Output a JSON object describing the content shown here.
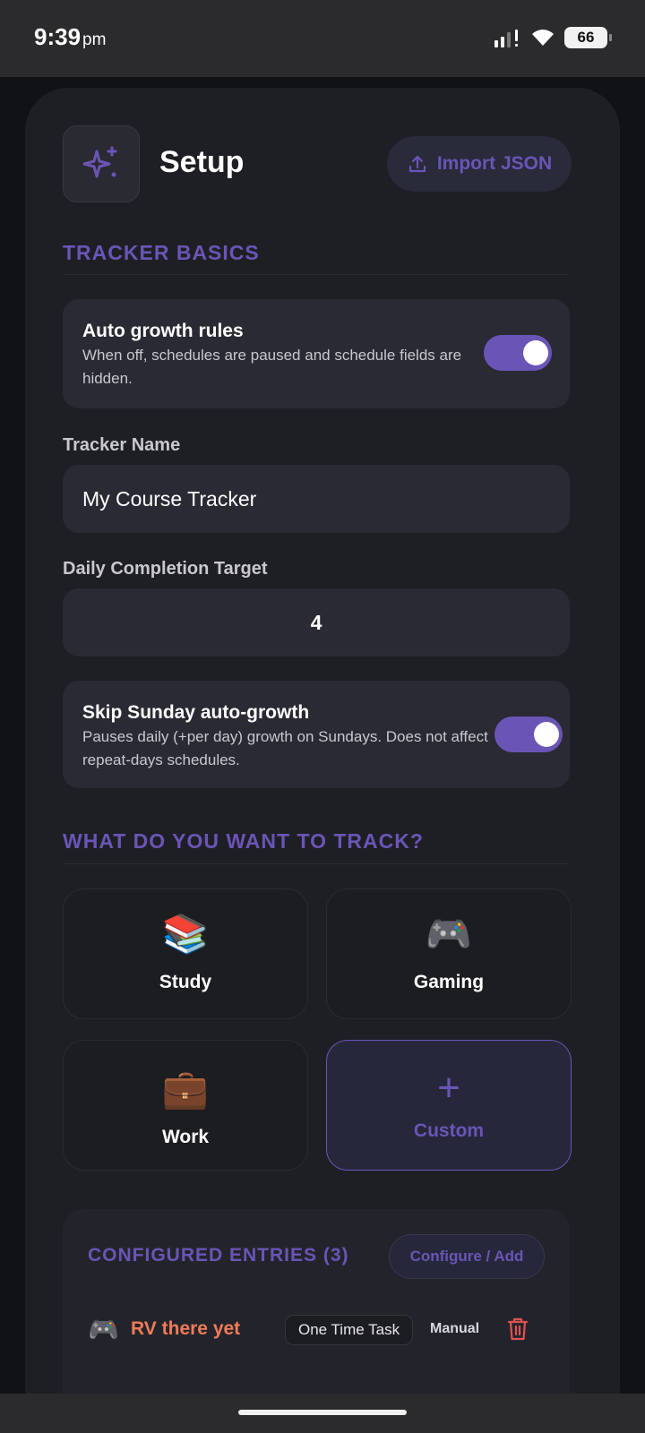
{
  "status": {
    "time": "9:39",
    "ampm": "pm",
    "battery": "66"
  },
  "header": {
    "title": "Setup",
    "import_label": "Import JSON"
  },
  "basics": {
    "section_title": "TRACKER BASICS",
    "auto_growth": {
      "title": "Auto growth rules",
      "desc_line1": "When off, schedules are paused and schedule fields are",
      "desc_line2": "hidden.",
      "enabled": true
    },
    "tracker_name": {
      "label": "Tracker Name",
      "value": "My Course Tracker"
    },
    "daily_target": {
      "label": "Daily Completion Target",
      "value": "4"
    },
    "skip_sunday": {
      "title": "Skip Sunday auto-growth",
      "desc_line1": "Pauses daily (+per day) growth on Sundays. Does not affect",
      "desc_line2": "repeat-days schedules.",
      "enabled": true
    }
  },
  "track": {
    "section_title": "WHAT DO YOU WANT TO TRACK?",
    "options": [
      {
        "label": "Study",
        "emoji": "📚"
      },
      {
        "label": "Gaming",
        "emoji": "🎮"
      },
      {
        "label": "Work",
        "emoji": "💼"
      },
      {
        "label": "Custom",
        "emoji": "+"
      }
    ],
    "selected": "Custom"
  },
  "entries": {
    "title": "CONFIGURED ENTRIES (3)",
    "configure_label": "Configure / Add",
    "items": [
      {
        "emoji": "🎮",
        "name": "RV there yet",
        "type": "One Time Task",
        "mode": "Manual"
      }
    ]
  },
  "colors": {
    "accent": "#6a55b6",
    "entry_name": "#ef7b57",
    "delete": "#e0524f"
  }
}
